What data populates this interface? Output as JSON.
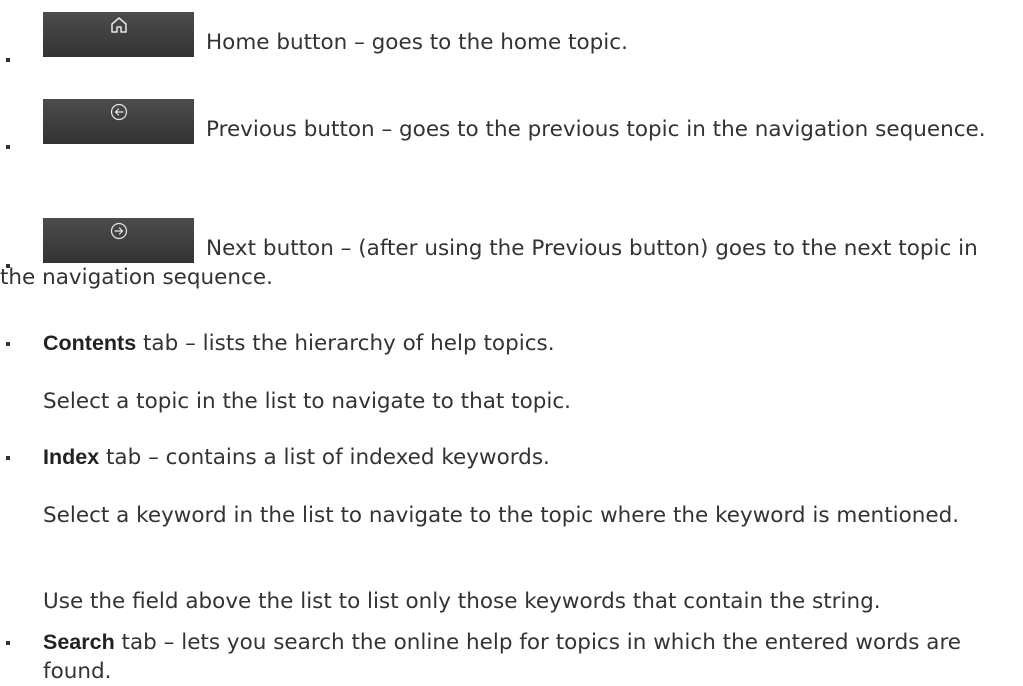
{
  "items": [
    {
      "text": "Home button – goes to the home topic.",
      "icon": "home-icon"
    },
    {
      "text": "Previous button – goes to the previous topic in the navigation sequence.",
      "icon": "arrow-left-circle-icon"
    },
    {
      "text": "Next button – (after using the Previous button) goes to the next topic in the navigation sequence.",
      "icon": "arrow-right-circle-icon"
    },
    {
      "bold": "Contents",
      "text": " tab – lists the hierarchy of help topics.",
      "note": "Select a topic in the list to navigate to that topic."
    },
    {
      "bold": "Index",
      "text": " tab – contains a list of indexed keywords.",
      "note1": "Select a keyword in the list to navigate to the topic where the keyword is mentioned.",
      "note2": "Use the field above the list to list only those keywords that contain the string."
    },
    {
      "bold": "Search",
      "text": " tab – lets you search the online help for topics in which the entered words are found."
    }
  ]
}
